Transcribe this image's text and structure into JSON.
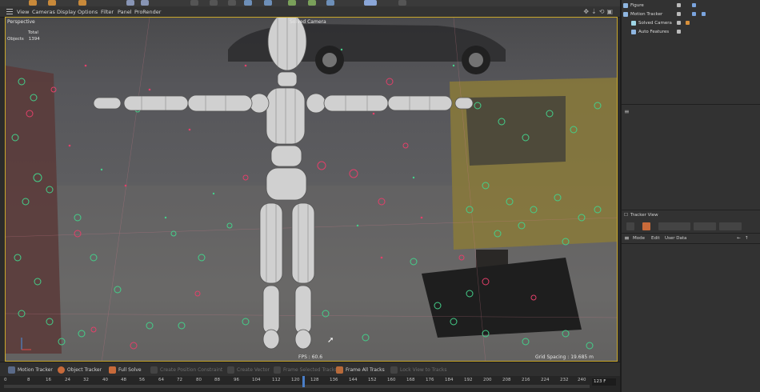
{
  "menu": {
    "items": [
      "View",
      "Cameras",
      "Display",
      "Options",
      "Filter",
      "Panel",
      "ProRender"
    ]
  },
  "viewport": {
    "name": "Perspective",
    "camera": "Solved Camera",
    "stats": {
      "total_label": "Total",
      "objects_label": "Objects",
      "objects_value": "1394"
    },
    "fps": "FPS : 60.6",
    "grid_spacing": "Grid Spacing : 19.685 m"
  },
  "bottombar": {
    "motion_tracker": "Motion Tracker",
    "object_tracker": "Object Tracker",
    "full_solve": "Full Solve",
    "create_position_constraint": "Create Position Constraint",
    "create_vector": "Create Vector",
    "frame_selected_tracks": "Frame Selected Tracks",
    "frame_all_tracks": "Frame All Tracks",
    "lock_view": "Lock View to Tracks"
  },
  "timeline": {
    "ticks": [
      "0",
      "8",
      "16",
      "24",
      "32",
      "40",
      "48",
      "56",
      "64",
      "72",
      "80",
      "88",
      "96",
      "104",
      "112",
      "120",
      "128",
      "136",
      "144",
      "152",
      "160",
      "168",
      "176",
      "184",
      "192",
      "200",
      "208",
      "216",
      "224",
      "232",
      "240"
    ],
    "current": "123 F"
  },
  "objects": {
    "items": [
      {
        "name": "Figure",
        "color": "#8fb6e0"
      },
      {
        "name": "Motion Tracker",
        "color": "#8fb6e0"
      },
      {
        "name": "Solved Camera",
        "color": "#9fd6e6"
      },
      {
        "name": "Auto Features",
        "color": "#8fb6e0"
      }
    ]
  },
  "tracker_view": {
    "label": "Tracker View"
  },
  "attributes": {
    "mode": "Mode",
    "edit": "Edit",
    "user_data": "User Data"
  },
  "colors": {
    "accent": "#c9a72a",
    "track_green": "#44d08a",
    "track_red": "#e2406a"
  }
}
